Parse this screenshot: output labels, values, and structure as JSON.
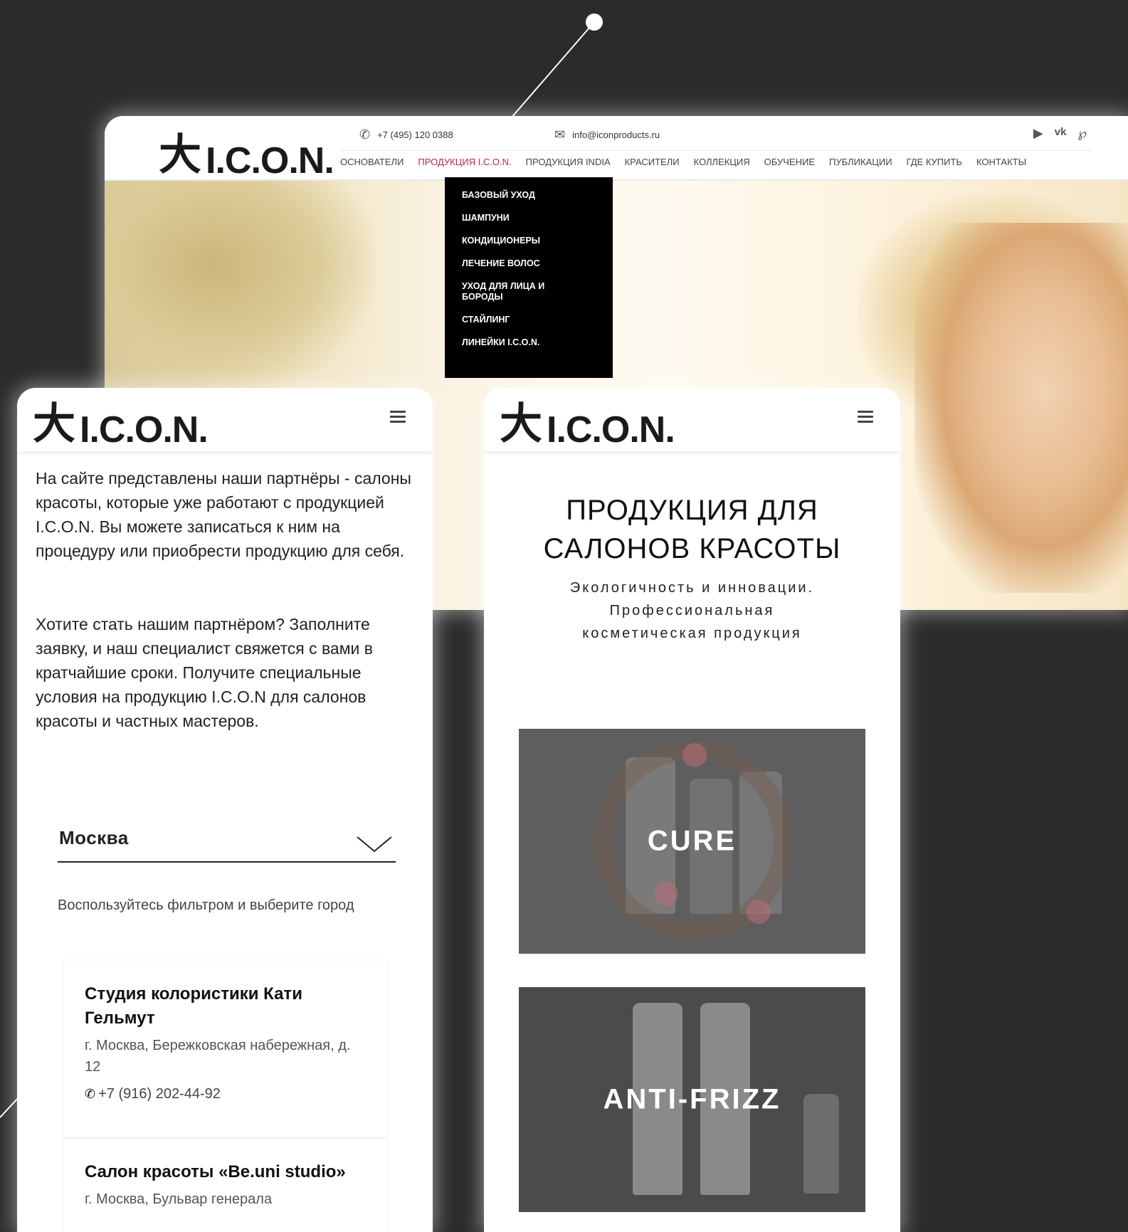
{
  "desktop": {
    "logo_mark": "大",
    "logo_word": "I.C.O.N.",
    "phone": "+7 (495) 120 0388",
    "email": "info@iconproducts.ru",
    "nav": [
      "ОСНОВАТЕЛИ",
      "ПРОДУКЦИЯ I.C.O.N.",
      "ПРОДУКЦИЯ INDIA",
      "КРАСИТЕЛИ",
      "КОЛЛЕКЦИЯ",
      "ОБУЧЕНИЕ",
      "ПУБЛИКАЦИИ",
      "ГДЕ КУПИТЬ",
      "КОНТАКТЫ"
    ],
    "nav_active": "ПРОДУКЦИЯ I.C.O.N.",
    "dropdown": [
      "БАЗОВЫЙ УХОД",
      "ШАМПУНИ",
      "КОНДИЦИОНЕРЫ",
      "ЛЕЧЕНИЕ ВОЛОС",
      "УХОД ДЛЯ ЛИЦА И БОРОДЫ",
      "СТАЙЛИНГ",
      "ЛИНЕЙКИ I.C.O.N."
    ],
    "social_icons": [
      "youtube-icon",
      "vk-icon",
      "pinterest-icon"
    ],
    "accent_color": "#c2214e"
  },
  "mobile_left": {
    "logo_mark": "大",
    "logo_word": "I.C.O.N.",
    "intro": "На сайте представлены наши партнёры - салоны красоты, которые уже работают с продукцией I.C.O.N. Вы можете записаться к ним на процедуру или приобрести продукцию для себя.",
    "cta": "Хотите стать нашим партнёром? Заполните заявку, и наш специалист свяжется с вами в кратчайшие сроки. Получите специальные условия на продукцию I.C.O.N для салонов красоты и частных мастеров.",
    "city": "Москва",
    "filter_hint": "Воспользуйтесь фильтром и выберите город",
    "salons": [
      {
        "name": "Студия колористики Кати Гельмут",
        "address": "г. Москва, Бережковская набережная, д. 12",
        "phone": "+7 (916) 202-44-92"
      },
      {
        "name": "Салон красоты «Be.uni studio»",
        "address": "г. Москва, Бульвар генерала"
      }
    ]
  },
  "mobile_right": {
    "logo_mark": "大",
    "logo_word": "I.C.O.N.",
    "title": "ПРОДУКЦИЯ ДЛЯ САЛОНОВ КРАСОТЫ",
    "subtitle": "Экологичность и инновации. Профессиональная косметическая продукция",
    "collections": [
      "CURE",
      "ANTI-FRIZZ"
    ]
  }
}
